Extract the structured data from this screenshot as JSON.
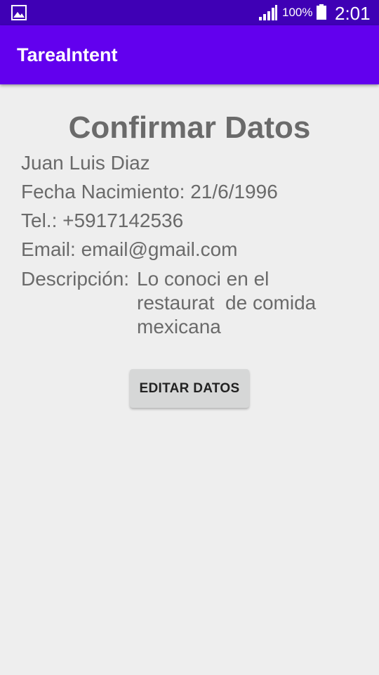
{
  "status_bar": {
    "battery_percent": "100%",
    "time": "2:01",
    "left_icon": "image-icon",
    "signal_icon": "signal-icon",
    "battery_icon": "battery-icon"
  },
  "app_bar": {
    "title": "TareaIntent"
  },
  "main": {
    "title": "Confirmar Datos",
    "name": "Juan Luis Diaz",
    "birth_date": "Fecha Nacimiento: 21/6/1996",
    "phone": "Tel.: +5917142536",
    "email": "Email: email@gmail.com",
    "description_label": "Descripción:",
    "description_value": "Lo conoci en el restaurat  de comida mexicana",
    "edit_button_label": "EDITAR DATOS"
  },
  "colors": {
    "status_bar": "#3f00b5",
    "app_bar": "#6200ee",
    "background": "#eeeeee",
    "text": "#6a6a6a",
    "button": "#d6d7d7"
  }
}
